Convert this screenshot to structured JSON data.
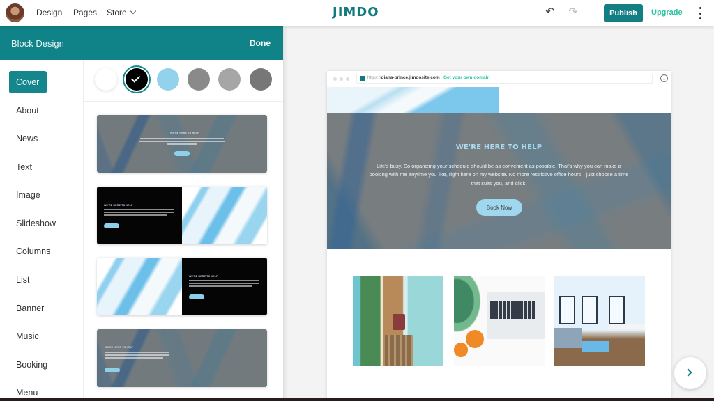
{
  "topbar": {
    "nav": [
      {
        "label": "Design"
      },
      {
        "label": "Pages"
      },
      {
        "label": "Store"
      }
    ],
    "logo": "JIMDO",
    "undo_icon": "↶",
    "redo_icon": "↷",
    "publish_label": "Publish",
    "upgrade_label": "Upgrade"
  },
  "panel": {
    "title": "Block Design",
    "done_label": "Done",
    "categories": [
      {
        "label": "Cover",
        "active": true
      },
      {
        "label": "About"
      },
      {
        "label": "News"
      },
      {
        "label": "Text"
      },
      {
        "label": "Image"
      },
      {
        "label": "Slideshow"
      },
      {
        "label": "Columns"
      },
      {
        "label": "List"
      },
      {
        "label": "Banner"
      },
      {
        "label": "Music"
      },
      {
        "label": "Booking"
      },
      {
        "label": "Menu"
      }
    ],
    "swatches": [
      {
        "color": "#ffffff",
        "selected": false
      },
      {
        "color": "#000000",
        "selected": true
      },
      {
        "color": "#93d2ec",
        "selected": false
      },
      {
        "color": "#8a8a8a",
        "selected": false
      },
      {
        "color": "#a6a6a6",
        "selected": false
      },
      {
        "color": "#777777",
        "selected": false
      }
    ],
    "layout_cards": [
      {
        "variant": "centered-overlay",
        "title": "WE'RE HERE TO HELP"
      },
      {
        "variant": "text-left-image-right",
        "title": "WE'RE HERE TO HELP"
      },
      {
        "variant": "image-left-text-right",
        "title": "WE'RE HERE TO HELP"
      },
      {
        "variant": "left-overlay",
        "title": "WE'RE HERE TO HELP"
      }
    ]
  },
  "preview": {
    "url_prefix": "https://",
    "url_domain": "diana-prince.jimdosite.com",
    "own_domain_label": "Get your own domain",
    "info_icon": "i",
    "hero": {
      "title": "WE'RE HERE TO HELP",
      "body": "Life's busy. So organizing your schedule should be as convenient as possible. That's why you can make a booking with me anytime you like, right here on my website. No more restrictive office hours—just choose a time that suits you, and click!",
      "button_label": "Book Now",
      "accent_color": "#a9daf1"
    },
    "photos": [
      {
        "subject": "greenhouse-doorway"
      },
      {
        "subject": "laptop-with-plants-and-oranges"
      },
      {
        "subject": "bright-office-interior"
      }
    ]
  },
  "colors": {
    "brand_teal": "#0f8388",
    "upgrade_green": "#2bc4a0"
  }
}
